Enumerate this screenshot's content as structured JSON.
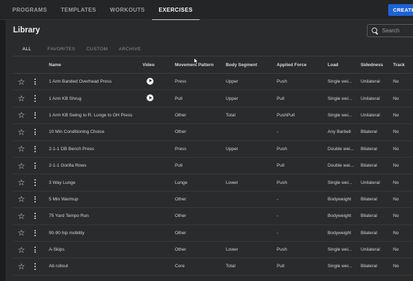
{
  "nav": {
    "tabs": [
      {
        "label": "PROGRAMS",
        "active": false
      },
      {
        "label": "TEMPLATES",
        "active": false
      },
      {
        "label": "WORKOUTS",
        "active": false
      },
      {
        "label": "EXERCISES",
        "active": true
      }
    ],
    "create_label": "CREATE"
  },
  "library": {
    "title": "Library",
    "search_placeholder": "Search",
    "subtabs": [
      {
        "label": "ALL",
        "active": true
      },
      {
        "label": "FAVORITES",
        "active": false
      },
      {
        "label": "CUSTOM",
        "active": false
      },
      {
        "label": "ARCHIVE",
        "active": false
      }
    ]
  },
  "table": {
    "columns": [
      "Name",
      "Video",
      "Movement Pattern",
      "Body Segment",
      "Applied Force",
      "Load",
      "Sidedness",
      "Track"
    ],
    "rows": [
      {
        "name": "1 Arm Banded Overhead Press",
        "video": true,
        "movement": "Press",
        "body": "Upper",
        "force": "Push",
        "load": "Single wei...",
        "side": "Unilateral",
        "track": "No"
      },
      {
        "name": "1 Arm KB Shrug",
        "video": true,
        "movement": "Pull",
        "body": "Upper",
        "force": "Pull",
        "load": "Single wei...",
        "side": "Unilateral",
        "track": "No"
      },
      {
        "name": "1 Arm KB Swing to R. Lunge to OH Press",
        "video": false,
        "movement": "Other",
        "body": "Total",
        "force": "PushPull",
        "load": "Single wei...",
        "side": "Unilateral",
        "track": "No"
      },
      {
        "name": "10 Min Conditioning Choice",
        "video": false,
        "movement": "Other",
        "body": "",
        "force": "-",
        "load": "Any Barbell",
        "side": "Bilateral",
        "track": "No"
      },
      {
        "name": "2-1-1 DB Bench Press",
        "video": false,
        "movement": "Press",
        "body": "Upper",
        "force": "Push",
        "load": "Double wei...",
        "side": "Bilateral",
        "track": "No"
      },
      {
        "name": "2-1-1 Gorilla Rows",
        "video": false,
        "movement": "Pull",
        "body": "",
        "force": "Pull",
        "load": "Double wei...",
        "side": "Bilateral",
        "track": "No"
      },
      {
        "name": "3 Way Lunge",
        "video": false,
        "movement": "Lunge",
        "body": "Lower",
        "force": "Push",
        "load": "Single wei...",
        "side": "Unilateral",
        "track": "No"
      },
      {
        "name": "5 Min Warmup",
        "video": false,
        "movement": "Other",
        "body": "",
        "force": "-",
        "load": "Bodyweight",
        "side": "Bilateral",
        "track": "No"
      },
      {
        "name": "75 Yard Tempo Run",
        "video": false,
        "movement": "Other",
        "body": "",
        "force": "-",
        "load": "Bodyweight",
        "side": "Bilateral",
        "track": "No"
      },
      {
        "name": "90-90 hip mobility",
        "video": false,
        "movement": "Other",
        "body": "",
        "force": "-",
        "load": "Bodyweight",
        "side": "Bilateral",
        "track": "No"
      },
      {
        "name": "A-Skips",
        "video": false,
        "movement": "Other",
        "body": "Lower",
        "force": "Push",
        "load": "Single wei...",
        "side": "Unilateral",
        "track": "No"
      },
      {
        "name": "Ab rollout",
        "video": false,
        "movement": "Core",
        "body": "Total",
        "force": "Pull",
        "load": "Single wei...",
        "side": "Bilateral",
        "track": "No"
      }
    ]
  },
  "colors": {
    "background": "#1b1c1e",
    "panel": "#2a2b2d",
    "accent": "#1e63d4"
  },
  "icons": {
    "star": "star-outline-icon",
    "more": "more-vert-icon",
    "play": "play-circle-icon",
    "search": "search-icon"
  }
}
